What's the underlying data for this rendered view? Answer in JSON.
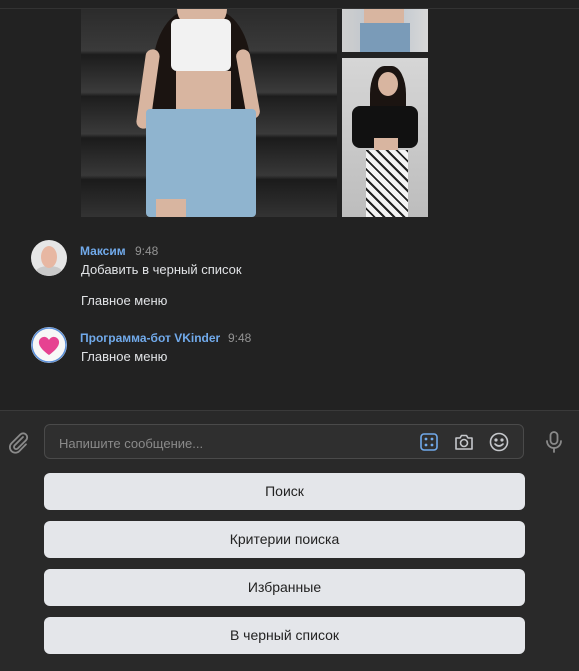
{
  "messages": [
    {
      "sender": "Максим",
      "time": "9:48",
      "lines": [
        "Добавить в черный список",
        "Главное меню"
      ]
    },
    {
      "sender": "Программа-бот VKinder",
      "time": "9:48",
      "lines": [
        "Главное меню"
      ]
    }
  ],
  "composer": {
    "placeholder": "Напишите сообщение..."
  },
  "keyboard": {
    "buttons": [
      "Поиск",
      "Критерии поиска",
      "Избранные",
      "В черный список"
    ]
  },
  "colors": {
    "background": "#222222",
    "sender_name": "#71aaeb",
    "button_bg": "#e4e6ea",
    "bot_avatar_heart": "#e64291"
  },
  "icons": [
    "paperclip-icon",
    "keyboard-icon",
    "camera-icon",
    "emoji-icon",
    "microphone-icon",
    "heart-icon"
  ]
}
